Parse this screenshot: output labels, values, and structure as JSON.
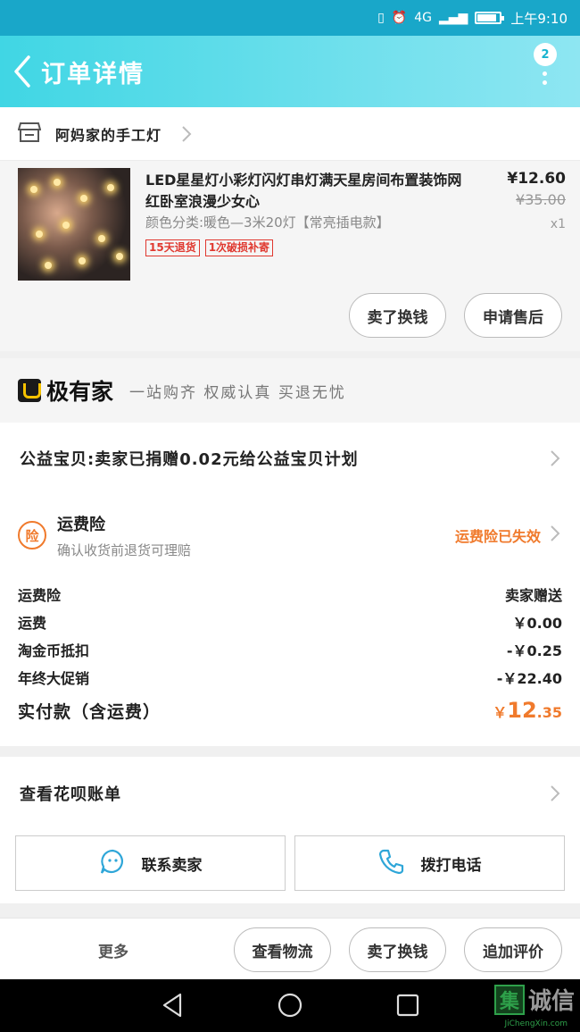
{
  "status_bar": {
    "signal": "4G",
    "time": "上午9:10",
    "battery_level": 0.85
  },
  "header": {
    "title": "订单详情",
    "badge_count": "2"
  },
  "shop": {
    "name": "阿妈家的手工灯"
  },
  "product": {
    "title": "LED星星灯小彩灯闪灯串灯满天星房间布置装饰网红卧室浪漫少女心",
    "spec": "颜色分类:暖色—3米20灯【常亮插电款】",
    "tags": [
      "15天退货",
      "1次破损补寄"
    ],
    "price_now": "¥12.60",
    "price_orig": "¥35.00",
    "qty": "x1",
    "btn_return": "卖了换钱",
    "btn_aftersale": "申请售后"
  },
  "brand": {
    "name": "极有家",
    "slogan": "一站购齐 权威认真 买退无忧"
  },
  "charity": {
    "text": "公益宝贝:卖家已捐赠0.02元给公益宝贝计划"
  },
  "insurance": {
    "icon_label": "险",
    "title": "运费险",
    "subtitle": "确认收货前退货可理赔",
    "status": "运费险已失效"
  },
  "fees": [
    {
      "label": "运费险",
      "value": "卖家赠送"
    },
    {
      "label": "运费",
      "value": "￥0.00"
    },
    {
      "label": "淘金币抵扣",
      "value": "-￥0.25"
    },
    {
      "label": "年终大促销",
      "value": "-￥22.40"
    }
  ],
  "total": {
    "label": "实付款（含运费）",
    "currency": "￥",
    "integer": "12",
    "decimal": ".35"
  },
  "bill": {
    "text": "查看花呗账单"
  },
  "contact": {
    "seller": "联系卖家",
    "phone": "拨打电话"
  },
  "bottom": {
    "more": "更多",
    "logistics": "查看物流",
    "resell": "卖了换钱",
    "review": "追加评价"
  },
  "watermark": {
    "char": "集",
    "name": "诚信",
    "site": "JiChengXin.com"
  },
  "colors": {
    "accent": "#f07a2c",
    "header": "#40d6e4",
    "tag_red": "#e0382f"
  }
}
